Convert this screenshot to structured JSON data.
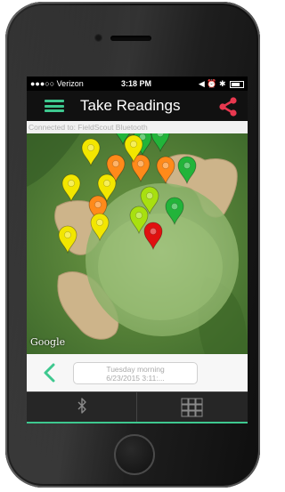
{
  "status_bar": {
    "carrier": "●●●○○ Verizon",
    "time": "3:18 PM",
    "right_icons": "◀ ⏰ ✱"
  },
  "nav": {
    "title": "Take Readings",
    "menu_icon": "hamburger-icon",
    "share_icon": "share-icon",
    "accent_color": "#3ec88f",
    "share_color": "#e8384f"
  },
  "connection": {
    "status_text": "Connected to: FieldScout Bluetooth"
  },
  "map": {
    "attribution": "Google",
    "marker_colors": {
      "yellow": "#f2e600",
      "light_green": "#a8e010",
      "green": "#22b43a",
      "orange": "#ff8a1a",
      "red": "#e01010"
    },
    "markers": [
      {
        "color": "yellow"
      },
      {
        "color": "yellow"
      },
      {
        "color": "yellow"
      },
      {
        "color": "green"
      },
      {
        "color": "green"
      },
      {
        "color": "green"
      },
      {
        "color": "orange"
      },
      {
        "color": "orange"
      },
      {
        "color": "orange"
      },
      {
        "color": "yellow"
      },
      {
        "color": "yellow"
      },
      {
        "color": "green"
      },
      {
        "color": "yellow"
      },
      {
        "color": "yellow"
      },
      {
        "color": "light_green"
      },
      {
        "color": "orange"
      },
      {
        "color": "light_green"
      },
      {
        "color": "green"
      },
      {
        "color": "yellow"
      },
      {
        "color": "yellow"
      },
      {
        "color": "red"
      }
    ]
  },
  "reading_nav": {
    "back_icon": "chevron-left-icon",
    "date_line1": "Tuesday morning",
    "date_line2": "6/23/2015 3:11:..."
  },
  "tabs": [
    {
      "icon": "bluetooth-icon"
    },
    {
      "icon": "grid-icon"
    }
  ]
}
